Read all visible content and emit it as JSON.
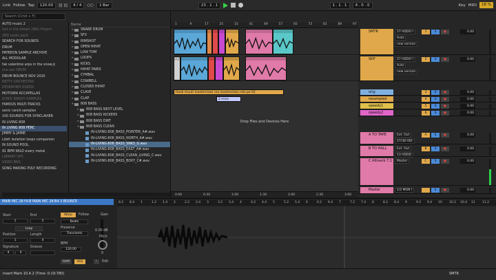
{
  "topbar": {
    "search_placeholder": "Search (Cmd + F)",
    "link": "Link",
    "follow": "Follow",
    "tap": "Tap",
    "tempo": "120.00",
    "tempo_extra": "||| |||",
    "time_sig": "4 / 4",
    "metro": "○○",
    "quant": "1 Bar",
    "position": "23 . 1 . 1",
    "loop_start": "1 . 1 . 1",
    "loop_len": "4 . 0 . 0",
    "key": "Key",
    "midi": "MIDI",
    "cpu": "18 %"
  },
  "browser": {
    "places": [
      {
        "label": "AUTO music 2",
        "dim": false
      },
      {
        "label": "lost in the dream (INS) Project",
        "dim": true
      },
      {
        "label": "2ND audio pack",
        "dim": true
      },
      {
        "label": "SEARCH FOR SOUNDS",
        "dim": false
      },
      {
        "label": "DRUM",
        "dim": false
      },
      {
        "label": "PATREON SAMPLE ARCHIVE",
        "dim": false
      },
      {
        "label": "ALL MODULAR",
        "dim": false
      },
      {
        "label": "fak valentine arps in the snow.jc",
        "dim": false
      },
      {
        "label": "one sec DRUM",
        "dim": true
      },
      {
        "label": "DRUM BOUNCE NOV 2020",
        "dim": false
      },
      {
        "label": "NETTY ORCHESTRA",
        "dim": true
      },
      {
        "label": "DESERHIER RISERS",
        "dim": true
      },
      {
        "label": "MOTOWN ACCAPELLAS",
        "dim": false
      },
      {
        "label": "SONIC RANCH SAMPLES",
        "dim": true
      },
      {
        "label": "FAMOUS MULTI-TRACKS",
        "dim": false
      },
      {
        "label": "sonic ranch samples",
        "dim": false
      },
      {
        "label": "100 SOUNDS FOR SYNCLAVIER",
        "dim": false
      },
      {
        "label": "IN LIVING 808",
        "dim": false
      },
      {
        "label": "IN LIVING 808 PERC",
        "dim": false,
        "sel": true
      },
      {
        "label": "JIMMY & JAMIE",
        "dim": false
      },
      {
        "label": "Lilett isolation loops companion",
        "dim": false
      },
      {
        "label": "IN SOUND POOL",
        "dim": false
      },
      {
        "label": "91 BPM WILD every metal",
        "dim": false
      },
      {
        "label": "LIBRARY UPS",
        "dim": true
      },
      {
        "label": "VIDEO BNS",
        "dim": true
      },
      {
        "label": "SONG MAKING POLY RECORDING",
        "dim": false
      }
    ],
    "name_header": "Name",
    "items": [
      {
        "label": "SNARE DRUM",
        "lvl": 0,
        "type": "folder"
      },
      {
        "label": "SFX",
        "lvl": 0,
        "type": "folder"
      },
      {
        "label": "RIMSHOT",
        "lvl": 0,
        "type": "folder"
      },
      {
        "label": "OPEN HIHAT",
        "lvl": 0,
        "type": "folder"
      },
      {
        "label": "LOW TOM",
        "lvl": 0,
        "type": "folder"
      },
      {
        "label": "LOOPS",
        "lvl": 0,
        "type": "folder"
      },
      {
        "label": "KICKS",
        "lvl": 0,
        "type": "folder"
      },
      {
        "label": "HIHAT PAIRS",
        "lvl": 0,
        "type": "folder"
      },
      {
        "label": "CYMBAL",
        "lvl": 0,
        "type": "folder"
      },
      {
        "label": "COWBELL",
        "lvl": 0,
        "type": "folder"
      },
      {
        "label": "CLOSED HIHAT",
        "lvl": 0,
        "type": "folder"
      },
      {
        "label": "CLAVE",
        "lvl": 0,
        "type": "folder"
      },
      {
        "label": "CLAP",
        "lvl": 0,
        "type": "folder"
      },
      {
        "label": "808 BASS",
        "lvl": 0,
        "type": "folder",
        "open": true
      },
      {
        "label": "808 BASS NEXT LEVEL",
        "lvl": 1,
        "type": "folder"
      },
      {
        "label": "808 BASS KICKERS",
        "lvl": 1,
        "type": "folder"
      },
      {
        "label": "808 BASS DIRT",
        "lvl": 1,
        "type": "folder"
      },
      {
        "label": "808 BASS CLEAN",
        "lvl": 1,
        "type": "folder",
        "open": true
      },
      {
        "label": "IN-LIVING-808_BASS_POINTER_A#.wav",
        "lvl": 2,
        "type": "file"
      },
      {
        "label": "IN-LIVING-808_BASS_NORTH_A#.wav",
        "lvl": 2,
        "type": "file"
      },
      {
        "label": "IN-LIVING-808_BASS_SNKS_G.wav",
        "lvl": 2,
        "type": "file",
        "sel": true
      },
      {
        "label": "IN-LIVING-808_BASS_EAST_A#.wav",
        "lvl": 2,
        "type": "file"
      },
      {
        "label": "IN-LIVING-808_BASS_CLEAN_LIVING_C.wav",
        "lvl": 2,
        "type": "file"
      },
      {
        "label": "IN-LIVING-808_BASS_BOXY_C#.wav",
        "lvl": 2,
        "type": "file"
      }
    ]
  },
  "arrangement": {
    "ruler": [
      "1",
      "9",
      "17",
      "25",
      "33",
      "41",
      "49",
      "57",
      "65",
      "73",
      "81",
      "89",
      "97"
    ],
    "locator": "1",
    "clip_bar_1": "Hook muuti masterclass rno   masterclass ndn.pe   02",
    "clip_bar_2": "2 mios",
    "drop_text": "Drop Files and Devices Here",
    "times": [
      "0:00",
      "0:30",
      "1:00",
      "1:30",
      "2:00",
      "2:30",
      "3:00"
    ]
  },
  "mixer": {
    "tracks": [
      {
        "name": "SMTR",
        "color": "#e0a84a",
        "io": "27 HDDO I",
        "mode": "Auto",
        "io2": "Off",
        "route": "new version",
        "vol": "0.00",
        "num": "1"
      },
      {
        "name": "SKP",
        "color": "#e0a84a",
        "io": "27 HDDO I",
        "mode": "Auto",
        "io2": "Off",
        "route": "new version",
        "vol": "0.00",
        "num": "2"
      },
      {
        "name": "orig",
        "color": "#7fb0e0",
        "vol": "0.00",
        "num": "3"
      },
      {
        "name": "resampled",
        "color": "#e0a84a",
        "vol": "0.00",
        "num": "4"
      },
      {
        "name": "speedy1",
        "color": "#e0c04a",
        "vol": "0.00",
        "num": "5"
      },
      {
        "name": "speedy2",
        "color": "#e066c8",
        "vol": "0.00",
        "num": "6"
      },
      {
        "name": "A TO TAPE",
        "color": "#e07aa8",
        "io": "Ext. Out",
        "route": "27/38 HDI",
        "vol": "0.00",
        "num": "A"
      },
      {
        "name": "B TO HALL",
        "color": "#e07aa8",
        "io": "Ext. Out",
        "route": "13 HDDD",
        "vol": "0.00",
        "num": "B"
      },
      {
        "name": "C Altiverb 7.1",
        "color": "#e07aa8",
        "io": "Master",
        "vol": "0.00",
        "num": "C"
      },
      {
        "name": "Master",
        "color": "#e07aa8",
        "io": "1/2 MON I",
        "vol": "0.00",
        "num": ""
      }
    ]
  },
  "detail": {
    "title": "MAIN MIC 28-Y4-B    MAIN MIC 28-B4-3    BOUNCE",
    "start_label": "Start",
    "end_label": "End",
    "start": "1",
    "end": "5",
    "loop_label": "Loop",
    "position_label": "Position",
    "length_label": "Length",
    "position": "1",
    "length": "4",
    "signature_label": "Signature",
    "groove_label": "Groove",
    "sig_num": "4",
    "sig_den": "4",
    "warp_label": "Warp",
    "follow_label": "Follow",
    "mode": "Beats",
    "preserve_label": "Preserve",
    "preserve": "Transients",
    "bpm_label": "BPM",
    "bpm": "120.00",
    "gain_label": "Gain",
    "gain": "0.00 dB",
    "pitch_label": "Pitch",
    "pitch": "0",
    "ram": "RAM",
    "hiq": "HiQ",
    "edit": "Edit",
    "ruler": [
      "8.2",
      "8.4",
      "1",
      "1.2",
      "1.4",
      "2",
      "2.2",
      "2.4",
      "3",
      "3.2",
      "3.4",
      "4",
      "4.2",
      "4.4",
      "5",
      "5.2",
      "5.4",
      "6",
      "6.2",
      "6.4",
      "7",
      "7.2",
      "7.4",
      "8",
      "8.2",
      "8.4",
      "9",
      "9.2",
      "9.4",
      "10",
      "10.2",
      "10.4",
      "11",
      "11.2"
    ]
  },
  "status": {
    "text": "Insert Mark 10.4.2 (Time: 0:19:780)",
    "track": "SMTR"
  }
}
